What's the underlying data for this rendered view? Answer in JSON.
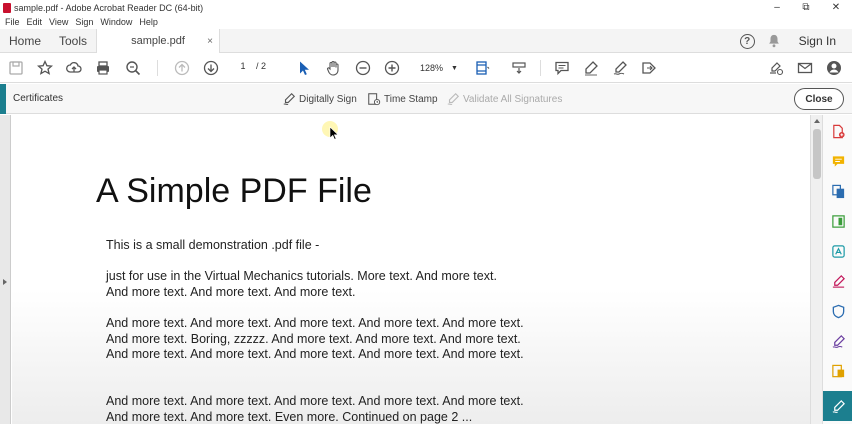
{
  "window": {
    "title": "sample.pdf - Adobe Acrobat Reader DC (64-bit)",
    "minimize": "–",
    "restore": "⧉",
    "close": "✕"
  },
  "menu": [
    "File",
    "Edit",
    "View",
    "Sign",
    "Window",
    "Help"
  ],
  "tabs": {
    "home": "Home",
    "tools": "Tools",
    "document": "sample.pdf",
    "doc_close": "×",
    "help": "?",
    "sign_in": "Sign In"
  },
  "toolbar": {
    "page_current": "1",
    "page_total": "/ 2",
    "zoom": "128%"
  },
  "certificates": {
    "title": "Certificates",
    "digitally_sign": "Digitally Sign",
    "time_stamp": "Time Stamp",
    "validate": "Validate All Signatures",
    "close": "Close"
  },
  "document": {
    "title": "A Simple PDF File",
    "paragraphs": [
      "This is a small demonstration .pdf file -",
      "just for use in the Virtual Mechanics tutorials. More text. And more text. And more text. And more text. And more text.",
      "And more text. And more text. And more text. And more text. And more text. And more text. Boring, zzzzz. And more text. And more text. And more text. And more text. And more text. And more text. And more text. And more text.",
      "And more text. And more text. And more text. And more text. And more text. And more text. And more text. Even more. Continued on page 2 ..."
    ]
  },
  "colors": {
    "accent": "#1c7f8f",
    "pdf_red": "#c8102e"
  }
}
